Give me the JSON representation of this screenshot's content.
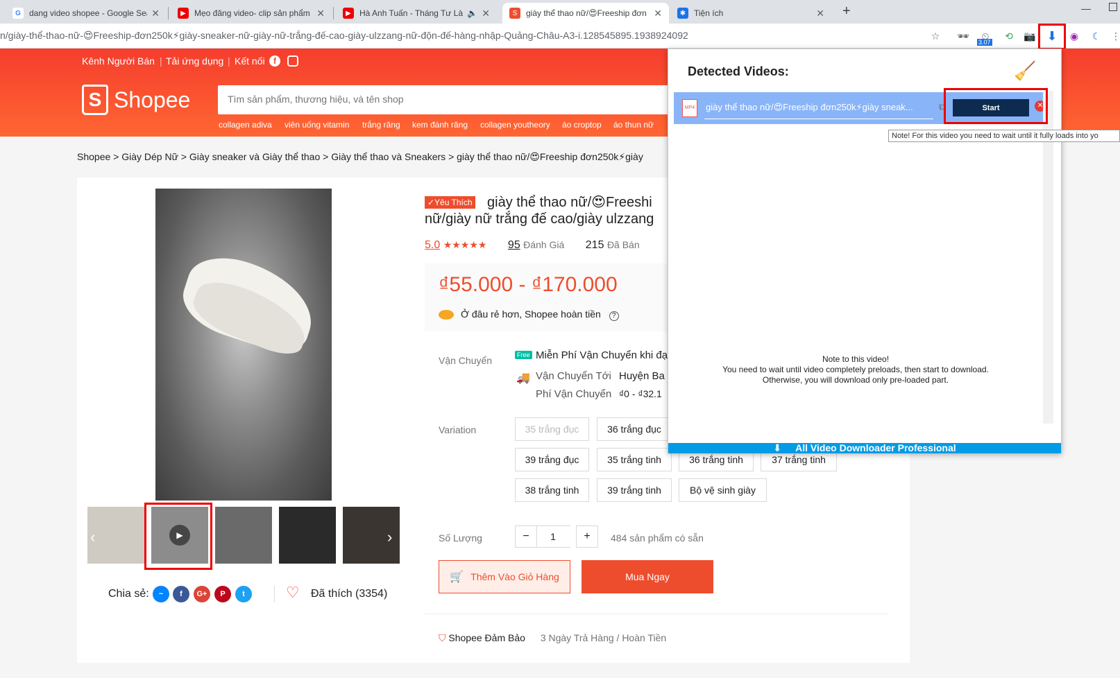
{
  "browser": {
    "tabs": [
      {
        "title": "dang video shopee - Google Sea",
        "icon": "G"
      },
      {
        "title": "Mẹo đăng video- clip sản phẩm",
        "icon": "▶"
      },
      {
        "title": "Hà Anh Tuấn - Tháng Tư Là Lời",
        "icon": "▶"
      },
      {
        "title": "giày thể thao nữ/😍Freeship đơn",
        "icon": "S"
      },
      {
        "title": "Tiện ích",
        "icon": "✱"
      }
    ],
    "new_tab": "+",
    "url": "n/giày-thể-thao-nữ-😍Freeship-đơn250k⚡giày-sneaker-nữ-giày-nữ-trắng-đế-cao-giày-ulzzang-nữ-độn-đế-hàng-nhập-Quảng-Châu-A3-i.128545895.1938924092",
    "ext_badge": "3.07"
  },
  "header": {
    "top_links": [
      "Kênh Người Bán",
      "Tải ứng dụng",
      "Kết nối"
    ],
    "logo": "Shopee",
    "search_placeholder": "Tìm sản phẩm, thương hiệu, và tên shop",
    "hot_keywords": [
      "collagen adiva",
      "viên uống vitamin",
      "trắng răng",
      "kem đánh răng",
      "collagen youtheory",
      "áo croptop",
      "áo thun nữ"
    ]
  },
  "breadcrumb": "Shopee  >  Giày Dép Nữ  >  Giày sneaker và Giày thể thao  >  Giày thể thao và Sneakers  >  giày thể thao nữ/😍Freeship đơn250k⚡giày",
  "product": {
    "badge": "✓Yêu Thích",
    "title_line1": "giày thể thao nữ/😍Freeshi",
    "title_line2": "nữ/giày nữ trắng đế cao/giày ulzzang",
    "rating": "5.0",
    "stars": "★★★★★",
    "reviews_count": "95",
    "reviews_label": "Đánh Giá",
    "sold_count": "215",
    "sold_label": "Đã Bán",
    "price": "₫55.000 - ₫170.000",
    "refund_text": "Ở đâu rẻ hơn, Shopee hoàn tiền",
    "shipping_label": "Vận Chuyển",
    "free_ship_badge": "Free",
    "free_ship": "Miễn Phí Vận Chuyển khi đạ",
    "ship_to_label": "Vận Chuyển Tới",
    "ship_to": "Huyện Ba",
    "ship_fee_label": "Phí Vận Chuyển",
    "ship_fee": "₫0 - ₫32.1",
    "variation_label": "Variation",
    "variations": [
      "35 trắng đục",
      "36 trắng đục",
      "39 trắng đục",
      "35 trắng tinh",
      "36 trắng tinh",
      "37 trắng tinh",
      "38 trắng tinh",
      "39 trắng tinh",
      "Bộ vệ sinh giày"
    ],
    "quantity_label": "Số Lượng",
    "quantity": "1",
    "stock": "484 sản phẩm có sẵn",
    "add_to_cart": "Thêm Vào Giỏ Hàng",
    "buy_now": "Mua Ngay",
    "share_label": "Chia sẻ:",
    "liked": "Đã thích (3354)",
    "guarantee": "Shopee Đảm Bảo",
    "guarantee_detail": "3 Ngày Trả Hàng / Hoàn Tiền"
  },
  "popup": {
    "title": "Detected Videos:",
    "video_name": "giày thể thao nữ/😍Freeship đơn250k⚡giày sneak...",
    "start": "Start",
    "tooltip": "Note! For this video you need to wait until it fully loads into yo",
    "note_line1": "Note to this video!",
    "note_line2": "You need to wait until video completely preloads, then start to download.",
    "note_line3": "Otherwise, you will download only pre-loaded part.",
    "footer": "All Video Downloader Professional"
  },
  "colors": {
    "brand": "#ee4d2d",
    "popup_row": "#8ab4f8",
    "popup_footer": "#039be5",
    "highlight": "#ee0000"
  }
}
